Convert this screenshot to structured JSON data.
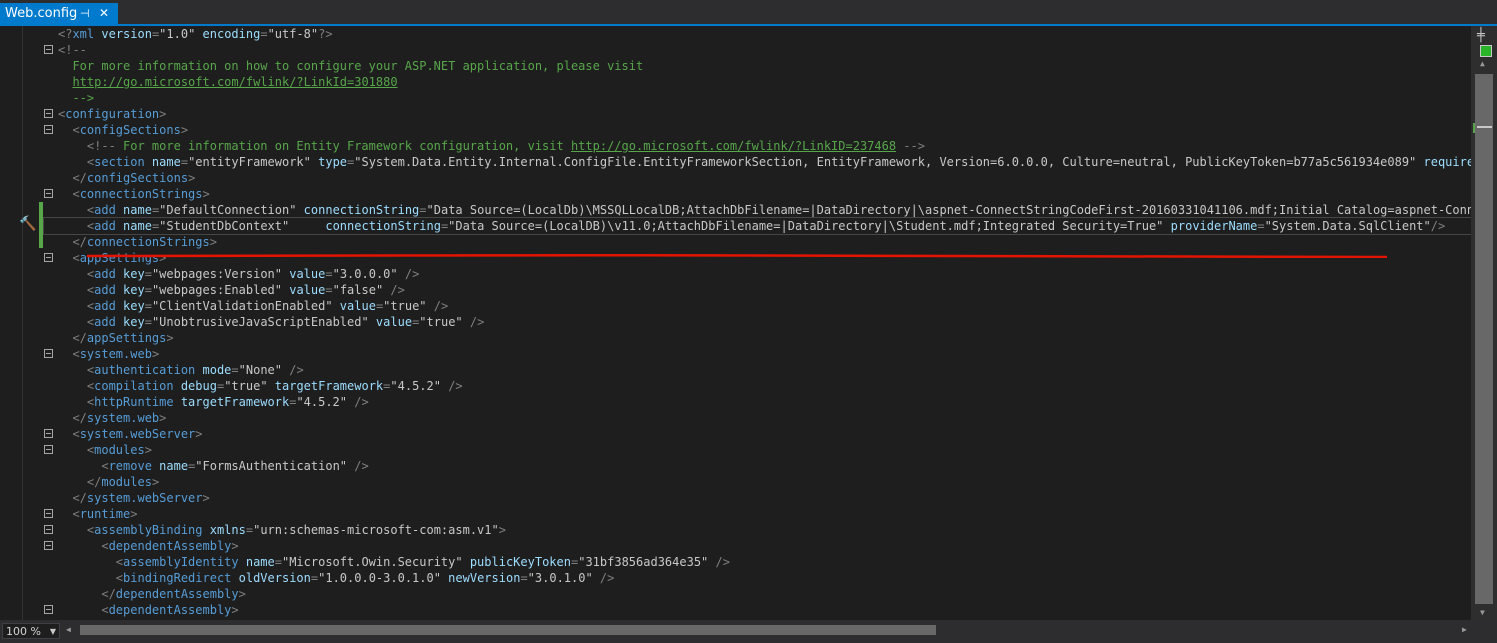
{
  "tab": {
    "title": "Web.config",
    "pin_glyph": "⊣",
    "close_glyph": "✕"
  },
  "zoom": {
    "value": "100 %"
  },
  "icons": {
    "splitter": "splitter-icon",
    "status": "check-icon",
    "hammer": "hammer-icon"
  },
  "colors": {
    "tab_active": "#007acc",
    "element": "#569cd6",
    "attribute": "#9cdcfe",
    "comment": "#57a64a",
    "annotation_underline": "#e51400"
  },
  "code_lines": [
    [
      [
        "d",
        "<?"
      ],
      [
        "e",
        "xml"
      ],
      [
        "a",
        " version"
      ],
      [
        "d",
        "="
      ],
      [
        "v",
        "\"1.0\""
      ],
      [
        "a",
        " encoding"
      ],
      [
        "d",
        "="
      ],
      [
        "v",
        "\"utf-8\""
      ],
      [
        "d",
        "?>"
      ]
    ],
    [
      [
        "d",
        "<!--"
      ]
    ],
    [
      [
        "c",
        "  For more information on how to configure your ASP.NET application, please visit"
      ]
    ],
    [
      [
        "c",
        "  "
      ],
      [
        "uc",
        "http://go.microsoft.com/fwlink/?LinkId=301880"
      ]
    ],
    [
      [
        "c",
        "  -->"
      ]
    ],
    [
      [
        "d",
        "<"
      ],
      [
        "e",
        "configuration"
      ],
      [
        "d",
        ">"
      ]
    ],
    [
      [
        "d",
        "  <"
      ],
      [
        "e",
        "configSections"
      ],
      [
        "d",
        ">"
      ]
    ],
    [
      [
        "d",
        "    <!--"
      ],
      [
        "c",
        " For more information on Entity Framework configuration, visit "
      ],
      [
        "uc",
        "http://go.microsoft.com/fwlink/?LinkID=237468"
      ],
      [
        "c",
        " "
      ],
      [
        "d",
        "-->"
      ]
    ],
    [
      [
        "d",
        "    <"
      ],
      [
        "e",
        "section"
      ],
      [
        "a",
        " name"
      ],
      [
        "d",
        "="
      ],
      [
        "v",
        "\"entityFramework\""
      ],
      [
        "a",
        " type"
      ],
      [
        "d",
        "="
      ],
      [
        "v",
        "\"System.Data.Entity.Internal.ConfigFile.EntityFrameworkSection, EntityFramework, Version=6.0.0.0, Culture=neutral, PublicKeyToken=b77a5c561934e089\""
      ],
      [
        "a",
        " requirePermis"
      ]
    ],
    [
      [
        "d",
        "  </"
      ],
      [
        "e",
        "configSections"
      ],
      [
        "d",
        ">"
      ]
    ],
    [
      [
        "d",
        "  <"
      ],
      [
        "e",
        "connectionStrings"
      ],
      [
        "d",
        ">"
      ]
    ],
    [
      [
        "d",
        "    <"
      ],
      [
        "e",
        "add"
      ],
      [
        "a",
        " name"
      ],
      [
        "d",
        "="
      ],
      [
        "v",
        "\"DefaultConnection\""
      ],
      [
        "a",
        " connectionString"
      ],
      [
        "d",
        "="
      ],
      [
        "v",
        "\"Data Source=(LocalDb)\\MSSQLLocalDB;AttachDbFilename=|DataDirectory|\\aspnet-ConnectStringCodeFirst-20160331041106.mdf;Initial Catalog=aspnet-ConnectStr"
      ]
    ],
    [
      [
        "d",
        "    <"
      ],
      [
        "e",
        "add"
      ],
      [
        "a",
        " name"
      ],
      [
        "d",
        "="
      ],
      [
        "v",
        "\"StudentDbContext\""
      ],
      [
        "a",
        "     connectionString"
      ],
      [
        "d",
        "="
      ],
      [
        "v",
        "\"Data Source=(LocalDB)\\v11.0;AttachDbFilename=|DataDirectory|\\Student.mdf;Integrated Security=True\""
      ],
      [
        "a",
        " providerName"
      ],
      [
        "d",
        "="
      ],
      [
        "v",
        "\"System.Data.SqlClient\""
      ],
      [
        "d",
        "/>"
      ]
    ],
    [
      [
        "d",
        "  </"
      ],
      [
        "e",
        "connectionStrings"
      ],
      [
        "d",
        ">"
      ]
    ],
    [
      [
        "d",
        "  <"
      ],
      [
        "e",
        "appSettings"
      ],
      [
        "d",
        ">"
      ]
    ],
    [
      [
        "d",
        "    <"
      ],
      [
        "e",
        "add"
      ],
      [
        "a",
        " key"
      ],
      [
        "d",
        "="
      ],
      [
        "v",
        "\"webpages:Version\""
      ],
      [
        "a",
        " value"
      ],
      [
        "d",
        "="
      ],
      [
        "v",
        "\"3.0.0.0\""
      ],
      [
        "d",
        " />"
      ]
    ],
    [
      [
        "d",
        "    <"
      ],
      [
        "e",
        "add"
      ],
      [
        "a",
        " key"
      ],
      [
        "d",
        "="
      ],
      [
        "v",
        "\"webpages:Enabled\""
      ],
      [
        "a",
        " value"
      ],
      [
        "d",
        "="
      ],
      [
        "v",
        "\"false\""
      ],
      [
        "d",
        " />"
      ]
    ],
    [
      [
        "d",
        "    <"
      ],
      [
        "e",
        "add"
      ],
      [
        "a",
        " key"
      ],
      [
        "d",
        "="
      ],
      [
        "v",
        "\"ClientValidationEnabled\""
      ],
      [
        "a",
        " value"
      ],
      [
        "d",
        "="
      ],
      [
        "v",
        "\"true\""
      ],
      [
        "d",
        " />"
      ]
    ],
    [
      [
        "d",
        "    <"
      ],
      [
        "e",
        "add"
      ],
      [
        "a",
        " key"
      ],
      [
        "d",
        "="
      ],
      [
        "v",
        "\"UnobtrusiveJavaScriptEnabled\""
      ],
      [
        "a",
        " value"
      ],
      [
        "d",
        "="
      ],
      [
        "v",
        "\"true\""
      ],
      [
        "d",
        " />"
      ]
    ],
    [
      [
        "d",
        "  </"
      ],
      [
        "e",
        "appSettings"
      ],
      [
        "d",
        ">"
      ]
    ],
    [
      [
        "d",
        "  <"
      ],
      [
        "e",
        "system.web"
      ],
      [
        "d",
        ">"
      ]
    ],
    [
      [
        "d",
        "    <"
      ],
      [
        "e",
        "authentication"
      ],
      [
        "a",
        " mode"
      ],
      [
        "d",
        "="
      ],
      [
        "v",
        "\"None\""
      ],
      [
        "d",
        " />"
      ]
    ],
    [
      [
        "d",
        "    <"
      ],
      [
        "e",
        "compilation"
      ],
      [
        "a",
        " debug"
      ],
      [
        "d",
        "="
      ],
      [
        "v",
        "\"true\""
      ],
      [
        "a",
        " targetFramework"
      ],
      [
        "d",
        "="
      ],
      [
        "v",
        "\"4.5.2\""
      ],
      [
        "d",
        " />"
      ]
    ],
    [
      [
        "d",
        "    <"
      ],
      [
        "e",
        "httpRuntime"
      ],
      [
        "a",
        " targetFramework"
      ],
      [
        "d",
        "="
      ],
      [
        "v",
        "\"4.5.2\""
      ],
      [
        "d",
        " />"
      ]
    ],
    [
      [
        "d",
        "  </"
      ],
      [
        "e",
        "system.web"
      ],
      [
        "d",
        ">"
      ]
    ],
    [
      [
        "d",
        "  <"
      ],
      [
        "e",
        "system.webServer"
      ],
      [
        "d",
        ">"
      ]
    ],
    [
      [
        "d",
        "    <"
      ],
      [
        "e",
        "modules"
      ],
      [
        "d",
        ">"
      ]
    ],
    [
      [
        "d",
        "      <"
      ],
      [
        "e",
        "remove"
      ],
      [
        "a",
        " name"
      ],
      [
        "d",
        "="
      ],
      [
        "v",
        "\"FormsAuthentication\""
      ],
      [
        "d",
        " />"
      ]
    ],
    [
      [
        "d",
        "    </"
      ],
      [
        "e",
        "modules"
      ],
      [
        "d",
        ">"
      ]
    ],
    [
      [
        "d",
        "  </"
      ],
      [
        "e",
        "system.webServer"
      ],
      [
        "d",
        ">"
      ]
    ],
    [
      [
        "d",
        "  <"
      ],
      [
        "e",
        "runtime"
      ],
      [
        "d",
        ">"
      ]
    ],
    [
      [
        "d",
        "    <"
      ],
      [
        "e",
        "assemblyBinding"
      ],
      [
        "a",
        " xmlns"
      ],
      [
        "d",
        "="
      ],
      [
        "v",
        "\"urn:schemas-microsoft-com:asm.v1\""
      ],
      [
        "d",
        ">"
      ]
    ],
    [
      [
        "d",
        "      <"
      ],
      [
        "e",
        "dependentAssembly"
      ],
      [
        "d",
        ">"
      ]
    ],
    [
      [
        "d",
        "        <"
      ],
      [
        "e",
        "assemblyIdentity"
      ],
      [
        "a",
        " name"
      ],
      [
        "d",
        "="
      ],
      [
        "v",
        "\"Microsoft.Owin.Security\""
      ],
      [
        "a",
        " publicKeyToken"
      ],
      [
        "d",
        "="
      ],
      [
        "v",
        "\"31bf3856ad364e35\""
      ],
      [
        "d",
        " />"
      ]
    ],
    [
      [
        "d",
        "        <"
      ],
      [
        "e",
        "bindingRedirect"
      ],
      [
        "a",
        " oldVersion"
      ],
      [
        "d",
        "="
      ],
      [
        "v",
        "\"1.0.0.0-3.0.1.0\""
      ],
      [
        "a",
        " newVersion"
      ],
      [
        "d",
        "="
      ],
      [
        "v",
        "\"3.0.1.0\""
      ],
      [
        "d",
        " />"
      ]
    ],
    [
      [
        "d",
        "      </"
      ],
      [
        "e",
        "dependentAssembly"
      ],
      [
        "d",
        ">"
      ]
    ],
    [
      [
        "d",
        "      <"
      ],
      [
        "e",
        "dependentAssembly"
      ],
      [
        "d",
        ">"
      ]
    ]
  ],
  "fold_lines": [
    1,
    5,
    6,
    10,
    14,
    20,
    25,
    26,
    30,
    31,
    32,
    36
  ],
  "current_line": 12
}
